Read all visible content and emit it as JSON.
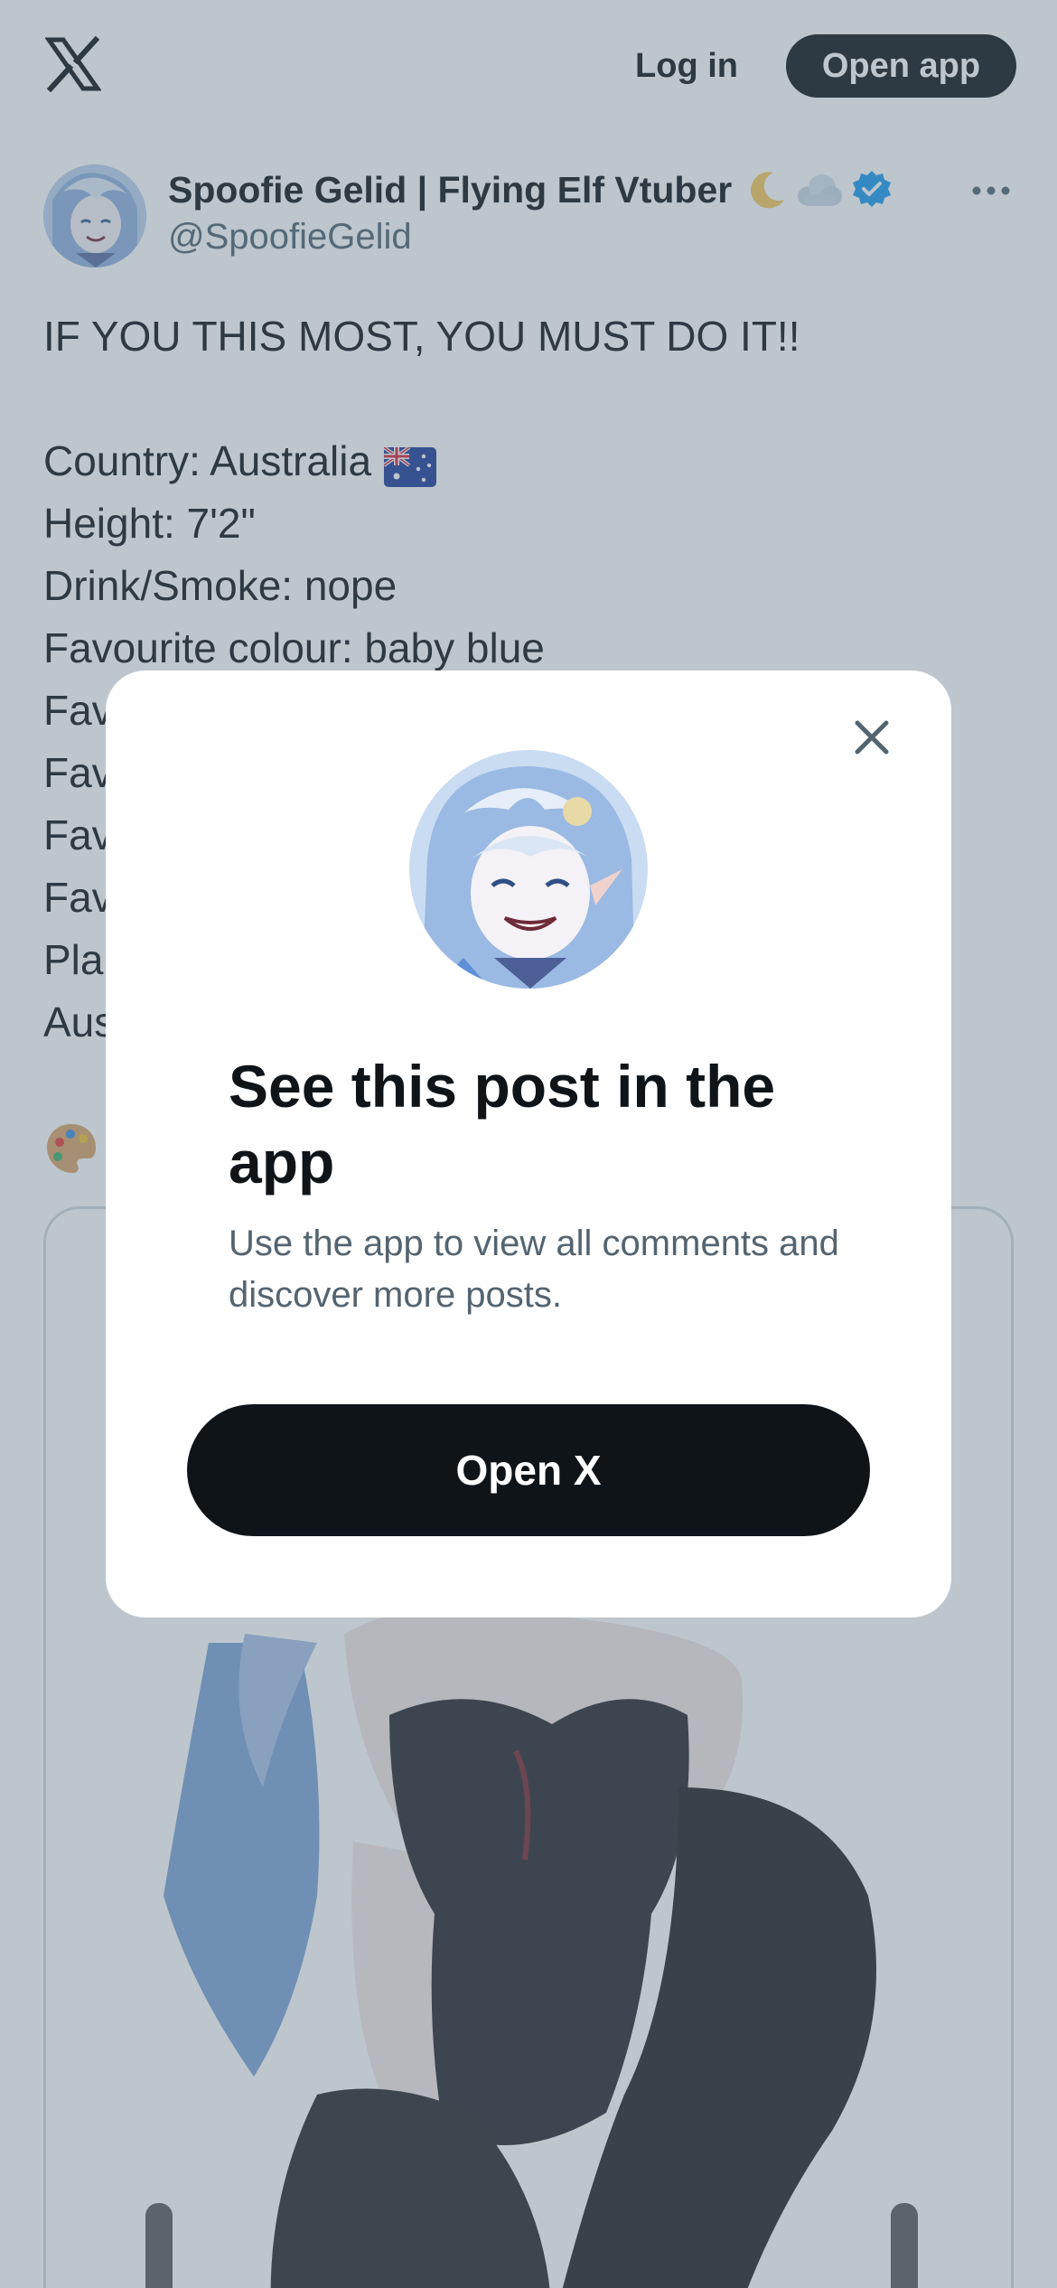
{
  "header": {
    "logo_icon": "x-logo-icon",
    "login_label": "Log in",
    "open_app_label": "Open app"
  },
  "post": {
    "display_name": "Spoofie Gelid | Flying Elf Vtuber",
    "name_emojis": [
      "crescent-moon-icon",
      "cloud-icon"
    ],
    "verified_icon": "verified-badge-icon",
    "handle": "@SpoofieGelid",
    "more_icon": "more-options-icon",
    "text_lines": [
      "IF YOU THIS MOST, YOU MUST DO IT!!",
      "",
      "Country: Australia",
      "Height: 7'2\"",
      "Drink/Smoke: nope",
      "Favourite colour: baby blue",
      "Fav",
      "Fav",
      "Fav",
      "Fav",
      "Pla",
      "Aus"
    ],
    "flag_icon": "australia-flag-icon",
    "palette_icon": "artist-palette-icon"
  },
  "modal": {
    "title": "See this post in the app",
    "subtitle": "Use the app to view all comments and discover more posts.",
    "button_label": "Open X",
    "close_icon": "close-icon"
  },
  "colors": {
    "primary_text": "#0f1419",
    "secondary_text": "#536471",
    "verified_blue": "#1d9bf0",
    "overlay": "rgba(91,112,131,0.40)"
  }
}
